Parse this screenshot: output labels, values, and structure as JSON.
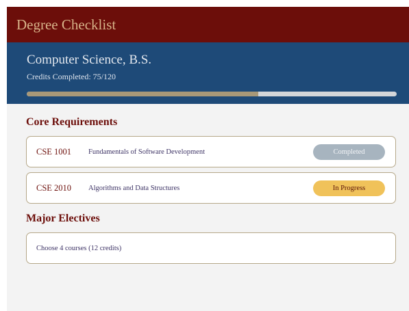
{
  "header": {
    "title": "Degree Checklist"
  },
  "program": {
    "name": "Computer Science, B.S.",
    "credits_text": "Credits Completed: 75/120",
    "credits_completed": 75,
    "credits_required": 120
  },
  "core": {
    "title": "Core Requirements",
    "courses": [
      {
        "code": "CSE 1001",
        "name": "Fundamentals of Software Development",
        "status": "Completed"
      },
      {
        "code": "CSE 2010",
        "name": "Algorithms and Data Structures",
        "status": "In Progress"
      }
    ]
  },
  "electives": {
    "title": "Major Electives",
    "note": "Choose 4 courses (12 credits)"
  },
  "colors": {
    "header_bg": "#6c0e0a",
    "program_bg": "#1e4a78",
    "progress_fill": "#a89878",
    "completed_badge": "#a7b4bf",
    "in_progress_badge": "#f0c25a"
  }
}
